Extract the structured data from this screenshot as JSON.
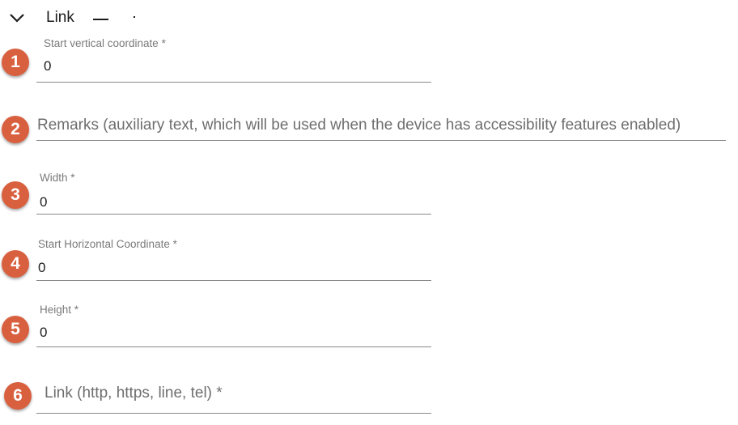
{
  "header": {
    "title": "Link",
    "collapse_icon": "chevron-down-icon"
  },
  "fields": [
    {
      "badge": "1",
      "label": "Start vertical coordinate *",
      "value": "0"
    },
    {
      "badge": "2",
      "placeholder": "Remarks (auxiliary text, which will be used when the device has accessibility features enabled)"
    },
    {
      "badge": "3",
      "label": "Width *",
      "value": "0"
    },
    {
      "badge": "4",
      "label": "Start Horizontal Coordinate *",
      "value": "0"
    },
    {
      "badge": "5",
      "label": "Height *",
      "value": "0"
    },
    {
      "badge": "6",
      "placeholder": "Link (http, https, line, tel) *"
    }
  ],
  "colors": {
    "badge": "#d9603f",
    "underline": "#8a8a8a"
  }
}
